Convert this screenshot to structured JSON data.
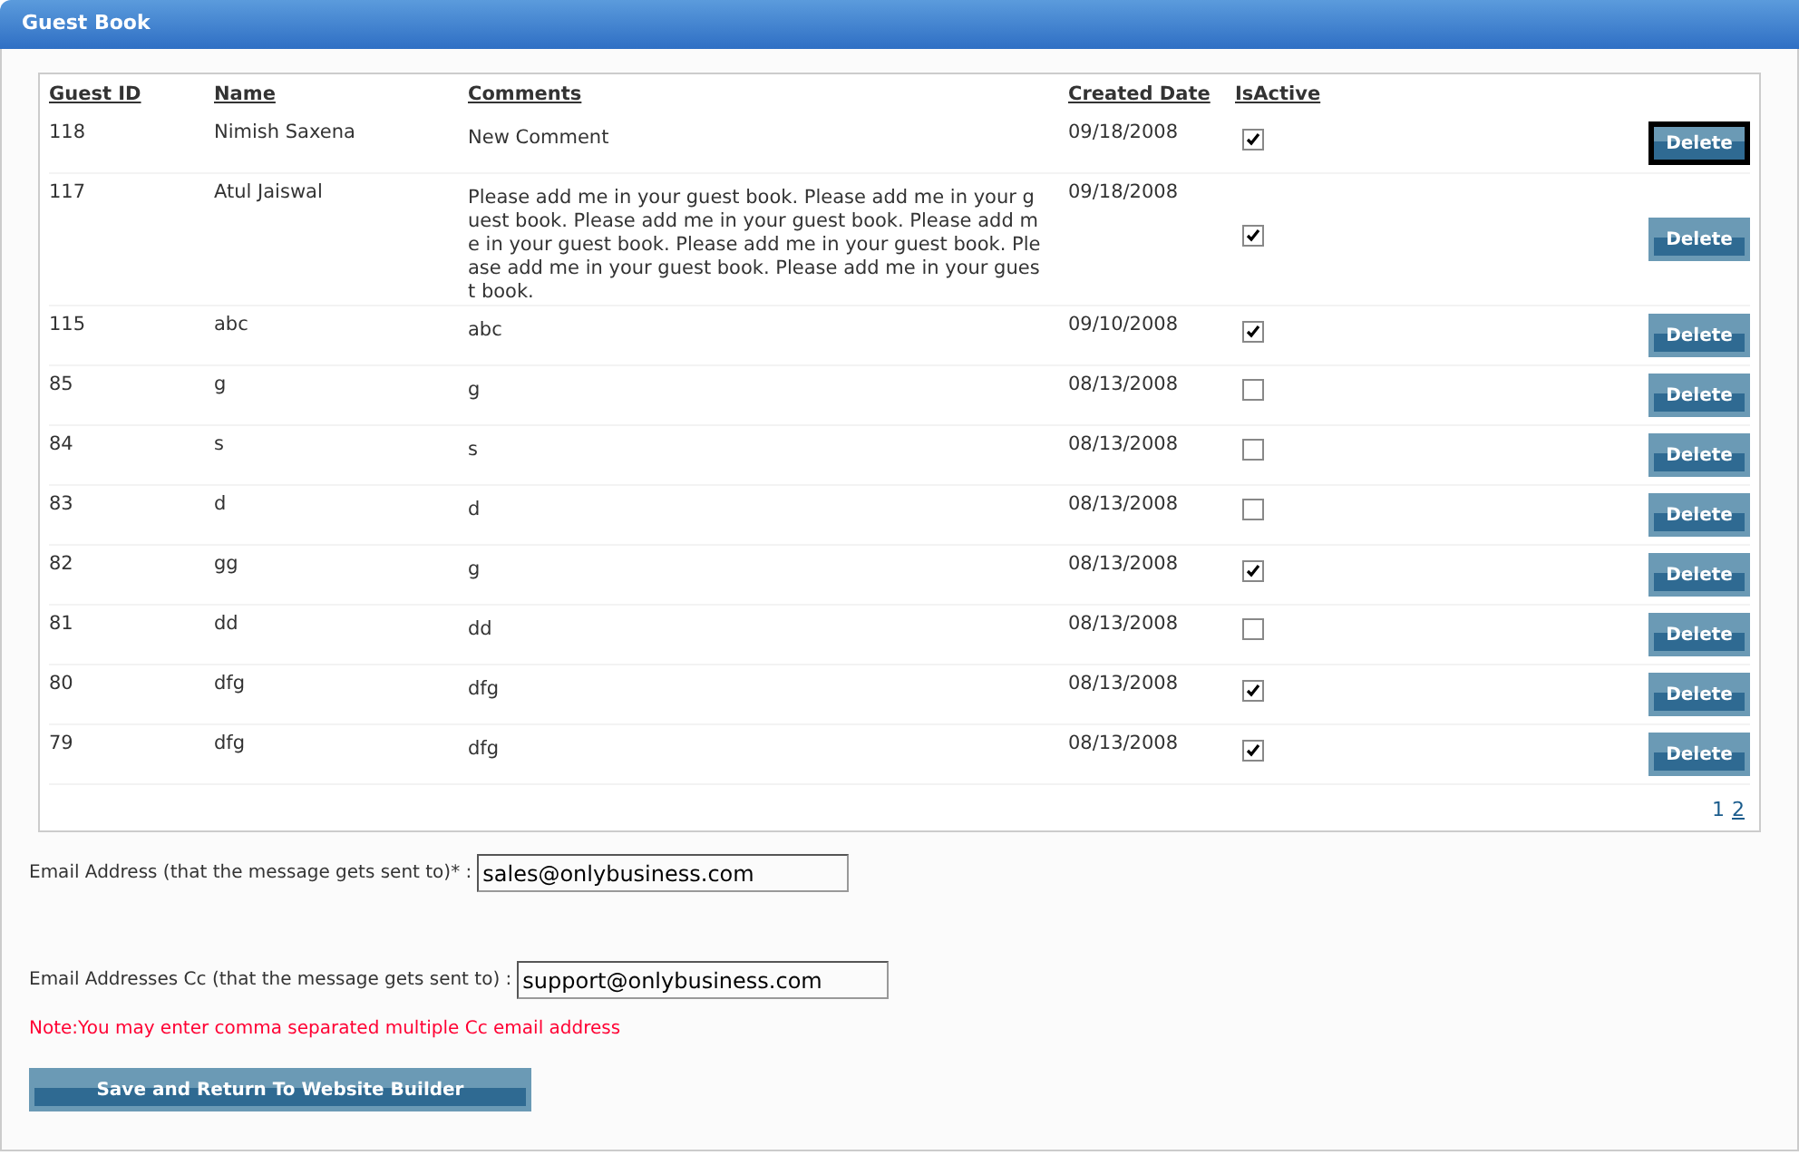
{
  "window": {
    "title": "Guest Book"
  },
  "table": {
    "columns": [
      "Guest ID",
      "Name",
      "Comments",
      "Created Date",
      "IsActive"
    ],
    "rows": [
      {
        "id": "118",
        "name": "Nimish Saxena",
        "comment": "New Comment",
        "date": "09/18/2008",
        "active": true,
        "action": "Delete",
        "focused": true
      },
      {
        "id": "117",
        "name": "Atul Jaiswal",
        "comment": "Please add me in your guest book. Please add me in your guest book. Please add me in your guest book. Please add me in your guest book. Please add me in your guest book. Please add me in your guest book. Please add me in your guest book.",
        "date": "09/18/2008",
        "active": true,
        "action": "Delete",
        "focused": false
      },
      {
        "id": "115",
        "name": "abc",
        "comment": "abc",
        "date": "09/10/2008",
        "active": true,
        "action": "Delete",
        "focused": false
      },
      {
        "id": "85",
        "name": "g",
        "comment": "g",
        "date": "08/13/2008",
        "active": false,
        "action": "Delete",
        "focused": false
      },
      {
        "id": "84",
        "name": "s",
        "comment": "s",
        "date": "08/13/2008",
        "active": false,
        "action": "Delete",
        "focused": false
      },
      {
        "id": "83",
        "name": "d",
        "comment": "d",
        "date": "08/13/2008",
        "active": false,
        "action": "Delete",
        "focused": false
      },
      {
        "id": "82",
        "name": "gg",
        "comment": "g",
        "date": "08/13/2008",
        "active": true,
        "action": "Delete",
        "focused": false
      },
      {
        "id": "81",
        "name": "dd",
        "comment": "dd",
        "date": "08/13/2008",
        "active": false,
        "action": "Delete",
        "focused": false
      },
      {
        "id": "80",
        "name": "dfg",
        "comment": "dfg",
        "date": "08/13/2008",
        "active": true,
        "action": "Delete",
        "focused": false
      },
      {
        "id": "79",
        "name": "dfg",
        "comment": "dfg",
        "date": "08/13/2008",
        "active": true,
        "action": "Delete",
        "focused": false
      }
    ]
  },
  "pagination": [
    {
      "label": "1",
      "selected": true
    },
    {
      "label": "2",
      "selected": false
    }
  ],
  "email": {
    "label": "Email Address (that the message gets sent to)* :",
    "value": "sales@onlybusiness.com"
  },
  "cc": {
    "label": "Email Addresses Cc (that the message gets sent to) :",
    "value": "support@onlybusiness.com"
  },
  "note": "Note:You may enter comma separated multiple Cc email address",
  "save_button": "Save and Return To Website Builder"
}
